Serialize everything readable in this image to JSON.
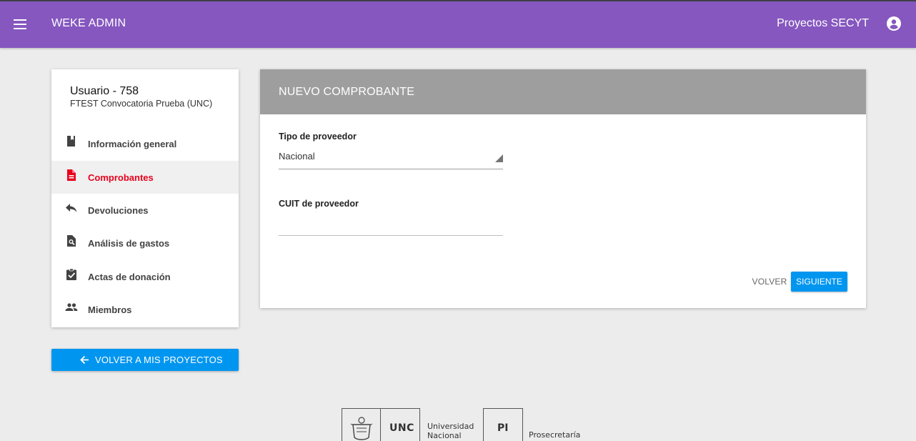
{
  "topbar": {
    "app_title": "WEKE ADMIN",
    "project_title": "Proyectos SECYT",
    "menu_icon": "menu-icon",
    "account_icon": "account-circle-icon",
    "color": "#8557bf"
  },
  "sidebar": {
    "user_name": "Usuario - 758",
    "user_subtitle": "FTEST Convocatoria Prueba (UNC)",
    "items": [
      {
        "label": "Información general",
        "icon": "book-icon",
        "active": false
      },
      {
        "label": "Comprobantes",
        "icon": "document-icon",
        "active": true
      },
      {
        "label": "Devoluciones",
        "icon": "reply-icon",
        "active": false
      },
      {
        "label": "Análisis de gastos",
        "icon": "find-in-page-icon",
        "active": false
      },
      {
        "label": "Actas de donación",
        "icon": "assignment-check-icon",
        "active": false
      },
      {
        "label": "Miembros",
        "icon": "people-icon",
        "active": false
      }
    ],
    "active_color": "#e8001c",
    "back_button_label": "VOLVER A MIS PROYECTOS"
  },
  "form": {
    "title": "NUEVO COMPROBANTE",
    "provider_type_label": "Tipo de proveedor",
    "provider_type_value": "Nacional",
    "cuit_label": "CUIT de proveedor",
    "cuit_value": "",
    "back_label": "VOLVER",
    "next_label": "SIGUIENTE",
    "accent_color": "#0096f0"
  },
  "footer": {
    "unc_logo_text": "UNC",
    "unc_name_line1": "Universidad",
    "unc_name_line2": "Nacional",
    "pi_logo_text": "PI",
    "pi_name": "Prosecretaría"
  }
}
